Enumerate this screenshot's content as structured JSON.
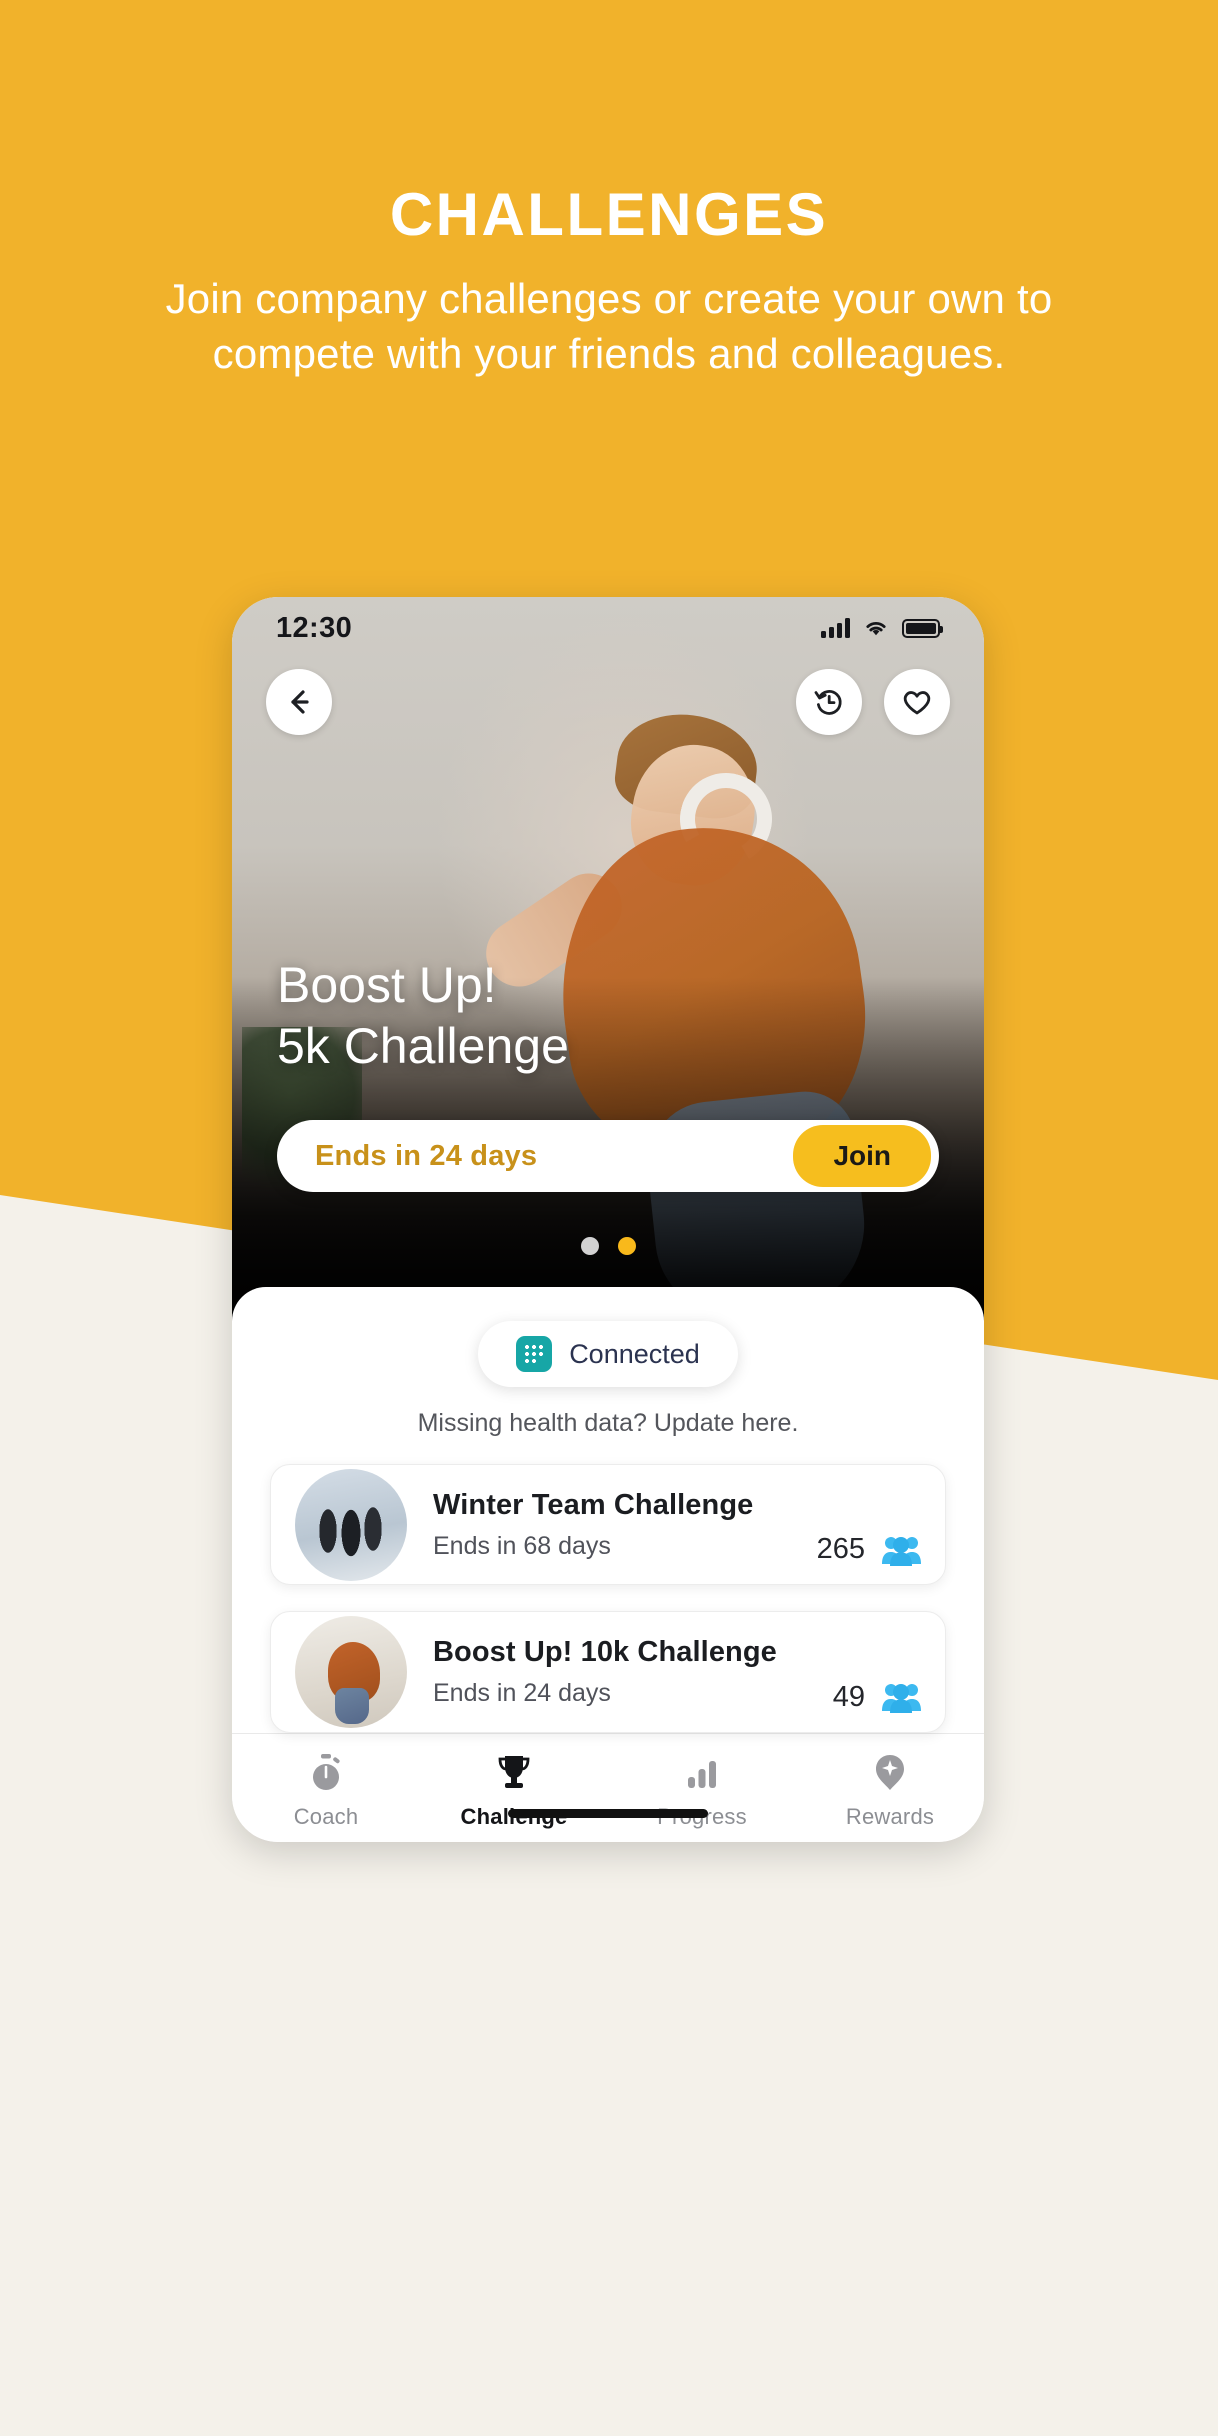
{
  "promo": {
    "title": "CHALLENGES",
    "subtitle": "Join company challenges or create your own to compete with your friends and colleagues.",
    "background_color": "#F1B22B",
    "lower_background_color": "#F4F1EA",
    "text_color": "#FFFFFF"
  },
  "phone": {
    "status_bar": {
      "time": "12:30",
      "signal_icon": "signal-bars-icon",
      "wifi_icon": "wifi-icon",
      "battery_icon": "battery-full-icon"
    },
    "hero": {
      "back_icon": "back-arrow-icon",
      "history_icon": "history-clock-icon",
      "favorite_icon": "heart-outline-icon",
      "title_line1": "Boost Up!",
      "title_line2": "5k Challenge",
      "ends_text": "Ends in 24 days",
      "ends_text_color": "#C8911A",
      "join_label": "Join",
      "join_color": "#F6BE1E",
      "dots": [
        {
          "active": false
        },
        {
          "active": true
        }
      ],
      "active_dot_color": "#F9B91B",
      "inactive_dot_color": "#D2D2D2"
    },
    "sheet": {
      "connected": {
        "icon": "fitbit-icon",
        "label": "Connected",
        "icon_color": "#17A6A6",
        "label_color": "#2B3350"
      },
      "missing_data_text": "Missing health data? Update here.",
      "challenges": [
        {
          "avatar": "group-jumping-photo",
          "title": "Winter Team Challenge",
          "ends": "Ends in 68 days",
          "participants": "265",
          "participants_icon": "people-group-icon"
        },
        {
          "avatar": "man-dancing-photo",
          "title": "Boost Up! 10k Challenge",
          "ends": "Ends in 24 days",
          "participants": "49",
          "participants_icon": "people-group-icon"
        }
      ],
      "participants_icon_color": "#3CB9F0"
    },
    "tabbar": {
      "tabs": [
        {
          "label": "Coach",
          "icon": "stopwatch-icon",
          "active": false
        },
        {
          "label": "Challenge",
          "icon": "trophy-icon",
          "active": true
        },
        {
          "label": "Progress",
          "icon": "bar-chart-icon",
          "active": false
        },
        {
          "label": "Rewards",
          "icon": "gem-icon",
          "active": false
        }
      ]
    }
  }
}
